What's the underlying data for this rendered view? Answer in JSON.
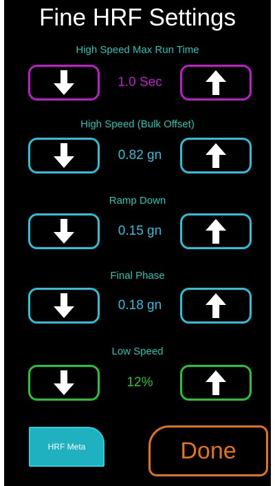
{
  "title": "Fine HRF Settings",
  "colors": {
    "background": "#000000",
    "label": "#19c9b5",
    "arrow": "#ffffff",
    "done": "#e87314",
    "meta_fill": "#1fb1c0"
  },
  "rows": [
    {
      "label": "High Speed Max Run Time",
      "value": "1.0 Sec",
      "color": "#c21ad0",
      "down_icon": "arrow-down-icon",
      "up_icon": "arrow-up-icon"
    },
    {
      "label": "High Speed (Bulk Offset)",
      "value": "0.82 gn",
      "color": "#23c4dc",
      "down_icon": "arrow-down-icon",
      "up_icon": "arrow-up-icon"
    },
    {
      "label": "Ramp Down",
      "value": "0.15 gn",
      "color": "#23c4dc",
      "down_icon": "arrow-down-icon",
      "up_icon": "arrow-up-icon"
    },
    {
      "label": "Final Phase",
      "value": "0.18 gn",
      "color": "#23c4dc",
      "down_icon": "arrow-down-icon",
      "up_icon": "arrow-up-icon"
    },
    {
      "label": "Low Speed",
      "value": "12%",
      "color": "#22c832",
      "down_icon": "arrow-down-icon",
      "up_icon": "arrow-up-icon"
    }
  ],
  "meta_button_label": "HRF Meta",
  "done_button_label": "Done"
}
